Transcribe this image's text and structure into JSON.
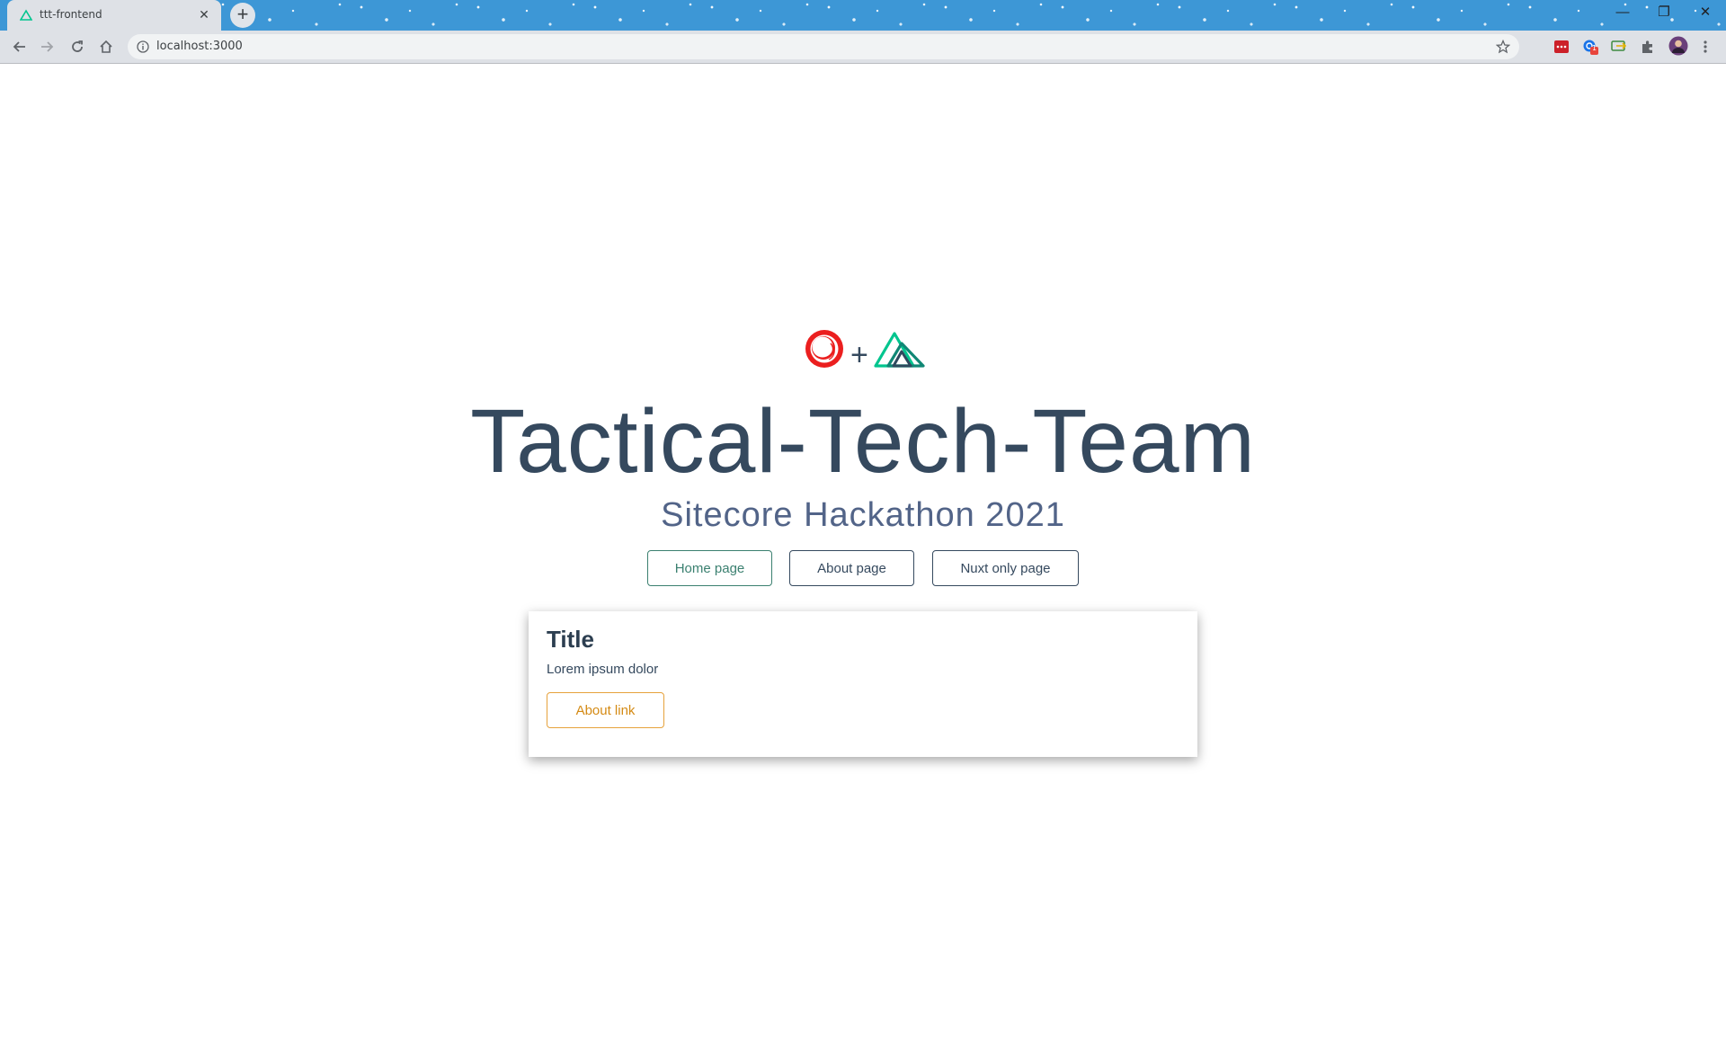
{
  "browser": {
    "tab_title": "ttt-frontend",
    "url": "localhost:3000",
    "new_tab_glyph": "+",
    "close_glyph": "✕",
    "window_controls": {
      "minimize": "—",
      "maximize": "❐",
      "close": "✕"
    },
    "extension_badge": "1"
  },
  "page": {
    "logo": {
      "left_icon": "sitecore-icon",
      "separator": "+",
      "right_icon": "nuxt-icon"
    },
    "headline": "Tactical-Tech-Team",
    "subtitle": "Sitecore Hackathon 2021",
    "nav_buttons": [
      {
        "label": "Home page"
      },
      {
        "label": "About page"
      },
      {
        "label": "Nuxt only page"
      }
    ],
    "card": {
      "title": "Title",
      "text": "Lorem ipsum dolor",
      "link_label": "About link"
    }
  },
  "colors": {
    "titlebar": "#3d97d6",
    "headline": "#35495e",
    "nuxt_green": "#00c58e",
    "sitecore_red": "#eb1f1f",
    "button_green": "#3b8070",
    "link_orange": "#e6a23c"
  }
}
